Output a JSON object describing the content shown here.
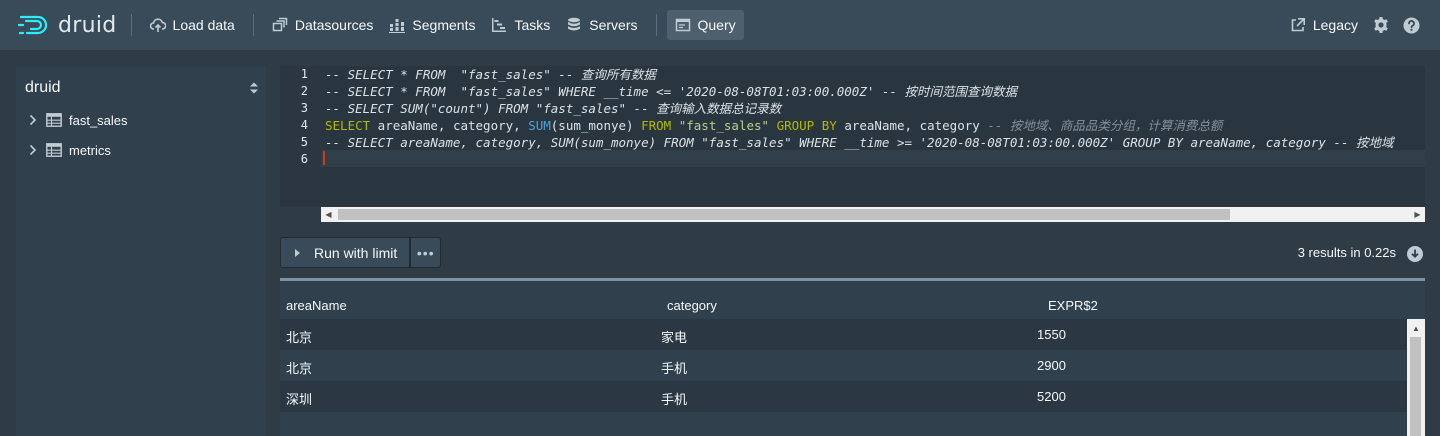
{
  "navbar": {
    "logo_text": "druid",
    "items": [
      {
        "label": "Load data",
        "icon": "cloud-upload-icon"
      },
      {
        "label": "Datasources",
        "icon": "multi-select-icon"
      },
      {
        "label": "Segments",
        "icon": "stacked-chart-icon"
      },
      {
        "label": "Tasks",
        "icon": "gantt-chart-icon"
      },
      {
        "label": "Servers",
        "icon": "database-icon"
      },
      {
        "label": "Query",
        "icon": "application-icon",
        "active": true
      }
    ],
    "legacy_label": "Legacy"
  },
  "sidebar": {
    "database": "druid",
    "tables": [
      "fast_sales",
      "metrics"
    ]
  },
  "editor": {
    "line_numbers": [
      "1",
      "2",
      "3",
      "4",
      "5",
      "6"
    ],
    "lines": {
      "l1": "-- SELECT * FROM  \"fast_sales\" -- 查询所有数据",
      "l2": "-- SELECT * FROM  \"fast_sales\" WHERE __time <= '2020-08-08T01:03:00.000Z' -- 按时间范围查询数据",
      "l3": "-- SELECT SUM(\"count\") FROM \"fast_sales\" -- 查询输入数据总记录数",
      "l4": {
        "kw_select": "SELECT",
        "cols": " areaName, category, ",
        "fn_sum": "SUM",
        "arg": "(sum_monye) ",
        "kw_from": "FROM",
        "sp1": " ",
        "table": "\"fast_sales\"",
        "sp2": " ",
        "kw_group": "GROUP BY",
        "group_cols": " areaName, category ",
        "comment": "-- 按地域、商品品类分组，计算消费总额"
      },
      "l5": "-- SELECT areaName, category, SUM(sum_monye) FROM \"fast_sales\" WHERE __time >= '2020-08-08T01:03:00.000Z' GROUP BY areaName, category -- 按地域"
    }
  },
  "run": {
    "label": "Run with limit",
    "more": "•••",
    "results_info": "3 results in 0.22s"
  },
  "table": {
    "headers": [
      "areaName",
      "category",
      "EXPR$2"
    ],
    "rows": [
      [
        "北京",
        "家电",
        "1550"
      ],
      [
        "北京",
        "手机",
        "2900"
      ],
      [
        "深圳",
        "手机",
        "5200"
      ]
    ]
  },
  "colors": {
    "navbar_bg": "#394b59",
    "page_bg": "#2f3b45",
    "keyword": "#b3b800",
    "function": "#4aa3df",
    "string": "#b4d18a",
    "comment": "#86909a"
  }
}
